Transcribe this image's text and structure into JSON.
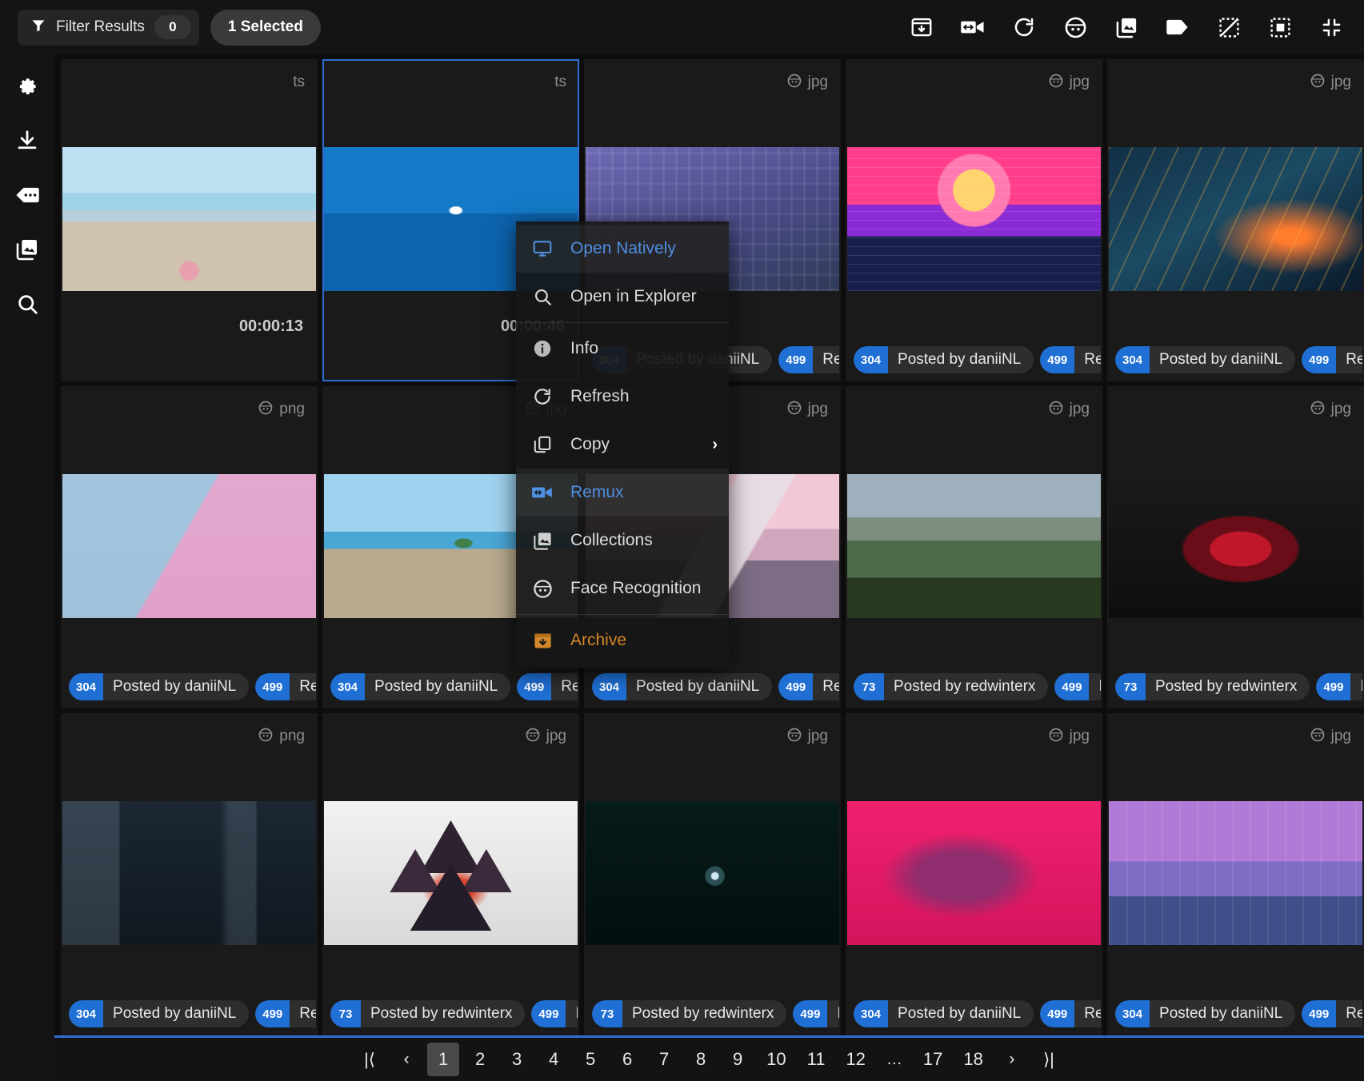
{
  "topbar": {
    "filter_label": "Filter Results",
    "filter_count": "0",
    "selected_label": "1 Selected",
    "tools": [
      {
        "name": "archive-icon",
        "title": "Archive"
      },
      {
        "name": "remux-icon",
        "title": "Remux"
      },
      {
        "name": "refresh-icon",
        "title": "Refresh"
      },
      {
        "name": "face-recognition-icon",
        "title": "Face Recognition"
      },
      {
        "name": "collections-icon",
        "title": "Collections"
      },
      {
        "name": "tag-icon",
        "title": "Tag"
      },
      {
        "name": "deselect-all-icon",
        "title": "Deselect All"
      },
      {
        "name": "select-all-icon",
        "title": "Select All"
      },
      {
        "name": "collapse-icon",
        "title": "Collapse"
      }
    ]
  },
  "sidebar": {
    "items": [
      {
        "name": "settings-icon",
        "label": "Settings"
      },
      {
        "name": "download-icon",
        "label": "Downloads"
      },
      {
        "name": "tag-dots-icon",
        "label": "Tags"
      },
      {
        "name": "collections-icon",
        "label": "Collections"
      },
      {
        "name": "search-icon",
        "label": "Search"
      }
    ]
  },
  "context_menu": {
    "items": [
      {
        "label": "Open Natively",
        "icon": "monitor-icon",
        "state": "highlight"
      },
      {
        "label": "Open in Explorer",
        "icon": "search-icon",
        "state": "normal"
      },
      {
        "separator_after": true
      },
      {
        "label": "Info",
        "icon": "info-icon",
        "state": "normal"
      },
      {
        "label": "Refresh",
        "icon": "refresh-icon",
        "state": "normal"
      },
      {
        "label": "Copy",
        "icon": "copy-icon",
        "state": "normal",
        "submenu": true,
        "chevron": "›"
      },
      {
        "label": "Remux",
        "icon": "remux-icon",
        "state": "highlight"
      },
      {
        "label": "Collections",
        "icon": "collections-icon",
        "state": "normal"
      },
      {
        "label": "Face Recognition",
        "icon": "face-icon",
        "state": "normal"
      },
      {
        "label": "Archive",
        "icon": "archive-icon",
        "state": "archive"
      }
    ]
  },
  "grid": {
    "cards": [
      {
        "ext": "ts",
        "has_face_icon": false,
        "duration": "00:00:13",
        "selected": false,
        "art": "beach-woman",
        "tags": []
      },
      {
        "ext": "ts",
        "has_face_icon": false,
        "duration": "00:00:46",
        "selected": true,
        "art": "bird-sea",
        "tags": []
      },
      {
        "ext": "jpg",
        "has_face_icon": true,
        "duration": "",
        "selected": false,
        "art": "purple-buildings",
        "tags": [
          {
            "num": "304",
            "txt": "Posted by daniiNL"
          },
          {
            "num": "499",
            "txt": "Reddit"
          }
        ]
      },
      {
        "ext": "jpg",
        "has_face_icon": true,
        "duration": "",
        "selected": false,
        "art": "synthwave-cassette",
        "tags": [
          {
            "num": "304",
            "txt": "Posted by daniiNL"
          },
          {
            "num": "499",
            "txt": "Reddit"
          }
        ]
      },
      {
        "ext": "jpg",
        "has_face_icon": true,
        "duration": "",
        "selected": false,
        "art": "ae86-night-drive",
        "tags": [
          {
            "num": "304",
            "txt": "Posted by daniiNL"
          },
          {
            "num": "499",
            "txt": "Reddit"
          }
        ]
      },
      {
        "ext": "png",
        "has_face_icon": true,
        "duration": "",
        "selected": false,
        "art": "pink-delorean",
        "tags": [
          {
            "num": "304",
            "txt": "Posted by daniiNL"
          },
          {
            "num": "499",
            "txt": "Reddit"
          }
        ]
      },
      {
        "ext": "jpg",
        "has_face_icon": true,
        "duration": "",
        "selected": false,
        "art": "island-sandbar",
        "tags": [
          {
            "num": "304",
            "txt": "Posted by daniiNL"
          },
          {
            "num": "499",
            "txt": "Reddit"
          }
        ]
      },
      {
        "ext": "jpg",
        "has_face_icon": true,
        "duration": "",
        "selected": false,
        "art": "pink-mountain",
        "tags": [
          {
            "num": "304",
            "txt": "Posted by daniiNL"
          },
          {
            "num": "499",
            "txt": "Reddit"
          }
        ]
      },
      {
        "ext": "jpg",
        "has_face_icon": true,
        "duration": "",
        "selected": false,
        "art": "valley-clouds",
        "tags": [
          {
            "num": "73",
            "txt": "Posted by redwinterx"
          },
          {
            "num": "499",
            "txt": "Reddit"
          }
        ]
      },
      {
        "ext": "jpg",
        "has_face_icon": true,
        "duration": "",
        "selected": false,
        "art": "red-fluid",
        "tags": [
          {
            "num": "73",
            "txt": "Posted by redwinterx"
          },
          {
            "num": "499",
            "txt": "Reddit"
          }
        ]
      },
      {
        "ext": "png",
        "has_face_icon": true,
        "duration": "",
        "selected": false,
        "art": "dark-interior",
        "tags": [
          {
            "num": "304",
            "txt": "Posted by daniiNL"
          },
          {
            "num": "499",
            "txt": "Reddit"
          }
        ]
      },
      {
        "ext": "jpg",
        "has_face_icon": true,
        "duration": "",
        "selected": false,
        "art": "triangles-space",
        "tags": [
          {
            "num": "73",
            "txt": "Posted by redwinterx"
          },
          {
            "num": "499",
            "txt": "Reddit"
          }
        ]
      },
      {
        "ext": "jpg",
        "has_face_icon": true,
        "duration": "",
        "selected": false,
        "art": "dark-planet",
        "tags": [
          {
            "num": "73",
            "txt": "Posted by redwinterx"
          },
          {
            "num": "499",
            "txt": "Reddit"
          }
        ]
      },
      {
        "ext": "jpg",
        "has_face_icon": true,
        "duration": "",
        "selected": false,
        "art": "pink-warrior",
        "tags": [
          {
            "num": "304",
            "txt": "Posted by daniiNL"
          },
          {
            "num": "499",
            "txt": "Reddit"
          }
        ]
      },
      {
        "ext": "jpg",
        "has_face_icon": true,
        "duration": "",
        "selected": false,
        "art": "neon-street",
        "tags": [
          {
            "num": "304",
            "txt": "Posted by daniiNL"
          },
          {
            "num": "499",
            "txt": "Reddit"
          }
        ]
      }
    ]
  },
  "pagination": {
    "first": "|⟨",
    "prev": "‹",
    "pages": [
      "1",
      "2",
      "3",
      "4",
      "5",
      "6",
      "7",
      "8",
      "9",
      "10",
      "11",
      "12",
      "…",
      "17",
      "18"
    ],
    "active": "1",
    "next": "›",
    "last": "⟩|"
  },
  "colors": {
    "accent_blue": "#2f6fd0",
    "badge_blue": "#1f6fd4",
    "archive_orange": "#d2872a",
    "menu_bg": "#171717"
  }
}
